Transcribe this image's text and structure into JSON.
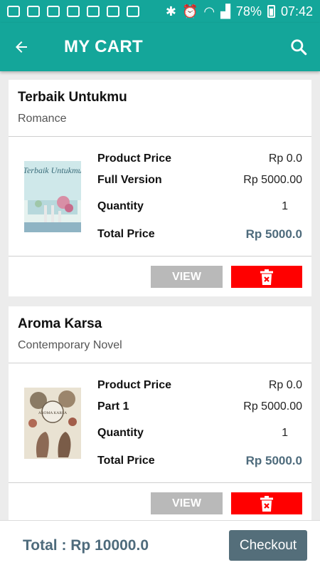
{
  "status_bar": {
    "battery": "78%",
    "time": "07:42"
  },
  "app_bar": {
    "title": "MY CART"
  },
  "cart": {
    "items": [
      {
        "title": "Terbaik Untukmu",
        "genre": "Romance",
        "product_price_label": "Product Price",
        "product_price": "Rp 0.0",
        "version_label": "Full Version",
        "version_price": "Rp 5000.00",
        "quantity_label": "Quantity",
        "quantity": "1",
        "total_label": "Total Price",
        "total_price": "Rp 5000.0",
        "view_label": "VIEW",
        "cover_title": "Terbaik Untukmu"
      },
      {
        "title": "Aroma Karsa",
        "genre": "Contemporary Novel",
        "product_price_label": "Product Price",
        "product_price": "Rp 0.0",
        "version_label": "Part 1",
        "version_price": "Rp 5000.00",
        "quantity_label": "Quantity",
        "quantity": "1",
        "total_label": "Total Price",
        "total_price": "Rp 5000.0",
        "view_label": "VIEW",
        "cover_title": "AROMA KARSA"
      }
    ]
  },
  "footer": {
    "total": "Total : Rp 10000.0",
    "checkout_label": "Checkout"
  },
  "colors": {
    "primary": "#14a69a",
    "accent_text": "#4e6b7c",
    "delete_button": "#ff0000",
    "view_button": "#b9b9b9",
    "checkout_button": "#546e7a"
  },
  "icons": [
    "back-arrow-icon",
    "search-icon",
    "trash-icon"
  ]
}
